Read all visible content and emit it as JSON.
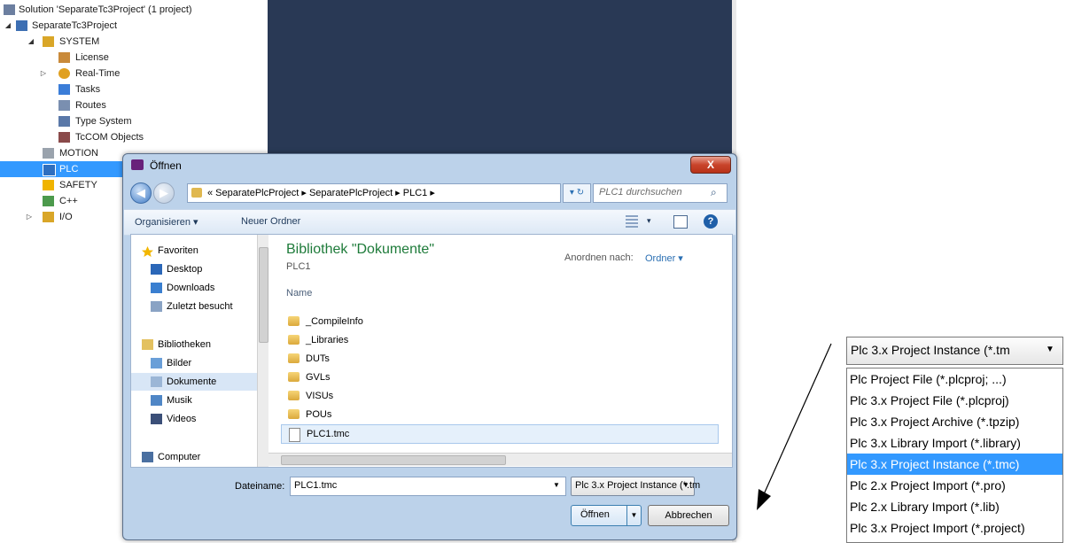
{
  "solution_explorer": {
    "items": [
      {
        "label": "Solution 'SeparateTc3Project' (1 project)",
        "expander": ""
      },
      {
        "label": "SeparateTc3Project",
        "expander": "◢"
      },
      {
        "label": "SYSTEM",
        "expander": "◢"
      },
      {
        "label": "License",
        "expander": ""
      },
      {
        "label": "Real-Time",
        "expander": "▷"
      },
      {
        "label": "Tasks",
        "expander": ""
      },
      {
        "label": "Routes",
        "expander": ""
      },
      {
        "label": "Type System",
        "expander": ""
      },
      {
        "label": "TcCOM Objects",
        "expander": ""
      },
      {
        "label": "MOTION",
        "expander": ""
      },
      {
        "label": "PLC",
        "expander": ""
      },
      {
        "label": "SAFETY",
        "expander": ""
      },
      {
        "label": "C++",
        "expander": ""
      },
      {
        "label": "I/O",
        "expander": "▷"
      }
    ]
  },
  "dialog": {
    "title": "Öffnen",
    "close": "X",
    "breadcrumb": "« SeparatePlcProject ▸ SeparatePlcProject ▸ PLC1 ▸",
    "search_placeholder": "PLC1 durchsuchen",
    "toolbar": {
      "organize": "Organisieren ▾",
      "new_folder": "Neuer Ordner"
    },
    "nav": [
      {
        "label": "Favoriten",
        "color": "#f2b600"
      },
      {
        "label": "Desktop",
        "color": "#2b67b8"
      },
      {
        "label": "Downloads",
        "color": "#3a7fd0"
      },
      {
        "label": "Zuletzt besucht",
        "color": "#8aa3c4"
      },
      {
        "label": "Bibliotheken",
        "color": "#e3c160"
      },
      {
        "label": "Bilder",
        "color": "#6a9fd8"
      },
      {
        "label": "Dokumente",
        "color": "#9bb6d6"
      },
      {
        "label": "Musik",
        "color": "#4f86c6"
      },
      {
        "label": "Videos",
        "color": "#3b4f78"
      },
      {
        "label": "Computer",
        "color": "#4a6fa0"
      }
    ],
    "library_title": "Bibliothek \"Dokumente\"",
    "library_sub": "PLC1",
    "arrange_label": "Anordnen nach:",
    "arrange_value": "Ordner ▾",
    "column_name": "Name",
    "files": [
      "_CompileInfo",
      "_Libraries",
      "DUTs",
      "GVLs",
      "VISUs",
      "POUs",
      "PLC1.tmc"
    ],
    "filename_label": "Dateiname:",
    "filename_value": "PLC1.tmc",
    "filetype_value": "Plc 3.x Project Instance (*.tm",
    "open_label": "Öffnen",
    "cancel_label": "Abbrechen"
  },
  "callout": {
    "selected": "Plc 3.x Project Instance (*.tm",
    "options": [
      "Plc Project File (*.plcproj; ...)",
      "Plc 3.x Project File (*.plcproj)",
      "Plc 3.x Project Archive (*.tpzip)",
      "Plc 3.x Library Import (*.library)",
      "Plc 3.x Project Instance (*.tmc)",
      "Plc 2.x Project Import (*.pro)",
      "Plc 2.x Library Import (*.lib)",
      "Plc 3.x Project Import (*.project)"
    ],
    "selected_index": 4
  }
}
